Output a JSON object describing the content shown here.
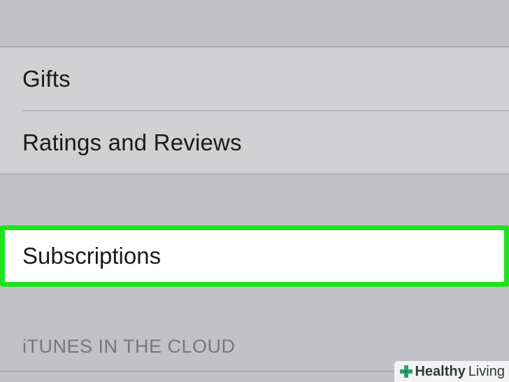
{
  "settings_list": {
    "group1": [
      {
        "label": "Gifts"
      },
      {
        "label": "Ratings and Reviews"
      }
    ],
    "highlighted_item": {
      "label": "Subscriptions"
    },
    "section_header": "iTUNES IN THE CLOUD"
  },
  "watermark": {
    "brand_bold": "Healthy",
    "brand_light": "Living",
    "icon": "medical-cross-icon",
    "accent_color": "#2e9e6a"
  },
  "colors": {
    "highlight_border": "#1ee21e",
    "background": "#c2c2c6"
  }
}
